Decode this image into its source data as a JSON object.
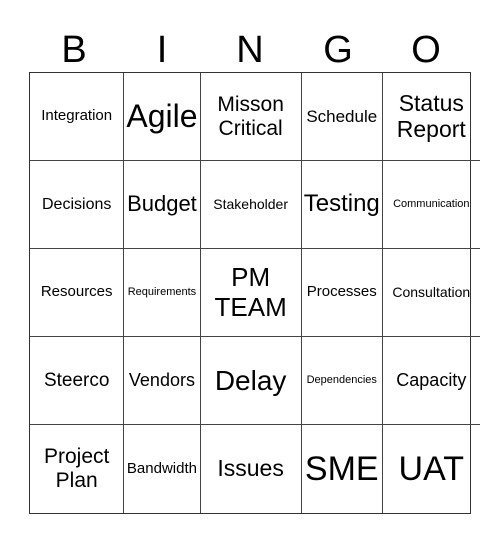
{
  "header": [
    "B",
    "I",
    "N",
    "G",
    "O"
  ],
  "cells": [
    "Integration",
    "Agile",
    "Misson Critical",
    "Schedule",
    "Status Report",
    "Decisions",
    "Budget",
    "Stakeholder",
    "Testing",
    "Communication",
    "Resources",
    "Requirements",
    "PM TEAM",
    "Processes",
    "Consultation",
    "Steerco",
    "Vendors",
    "Delay",
    "Dependencies",
    "Capacity",
    "Project Plan",
    "Bandwidth",
    "Issues",
    "SME",
    "UAT"
  ]
}
